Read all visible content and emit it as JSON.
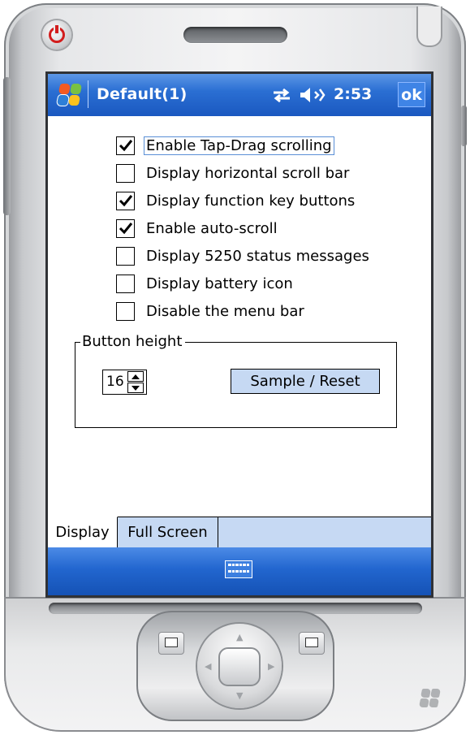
{
  "device": {
    "form": "Windows Mobile Pocket PC"
  },
  "titlebar": {
    "title": "Default(1)",
    "clock": "2:53",
    "ok_label": "ok",
    "icons": [
      "start-logo-icon",
      "connectivity-icon",
      "volume-icon"
    ]
  },
  "options": [
    {
      "label": "Enable Tap-Drag scrolling",
      "checked": true
    },
    {
      "label": "Display horizontal scroll bar",
      "checked": false
    },
    {
      "label": "Display function key buttons",
      "checked": true
    },
    {
      "label": "Enable auto-scroll",
      "checked": true
    },
    {
      "label": "Display 5250 status messages",
      "checked": false
    },
    {
      "label": "Display battery icon",
      "checked": false
    },
    {
      "label": "Disable the menu bar",
      "checked": false
    }
  ],
  "button_height": {
    "legend": "Button height",
    "value": "16",
    "sample_label": "Sample / Reset"
  },
  "tabs": [
    {
      "label": "Display",
      "active": true
    },
    {
      "label": "Full Screen",
      "active": false
    }
  ],
  "softbar": {
    "icon": "keyboard-icon"
  },
  "colors": {
    "titlebar": "#2b6fd3",
    "tab_strip": "#c6d9f3",
    "button_fill": "#c6d9f3",
    "power_red": "#d21d1d"
  }
}
